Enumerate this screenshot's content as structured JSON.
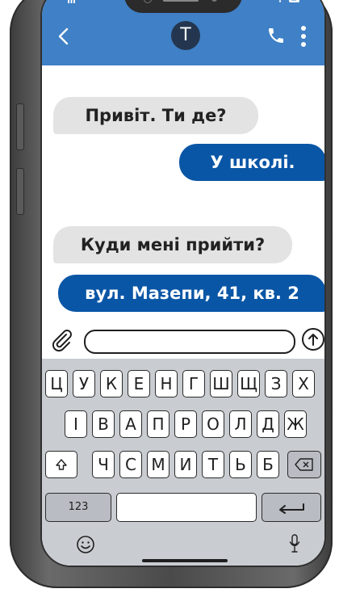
{
  "header": {
    "contact_initial": "T",
    "colors": {
      "bar": "#3f80c6",
      "avatar": "#24364f"
    },
    "icons": [
      "signal-icon",
      "wifi-icon",
      "battery-icon",
      "back-icon",
      "phone-call-icon",
      "more-icon"
    ]
  },
  "messages": [
    {
      "direction": "incoming",
      "text": "Привіт. Ти де?"
    },
    {
      "direction": "outgoing",
      "text": "У школі."
    },
    {
      "direction": "incoming",
      "text": "Куди мені прийти?"
    },
    {
      "direction": "outgoing",
      "text": "вул. Мазепи, 41, кв. 2"
    }
  ],
  "colors": {
    "incoming_bubble": "#e3e3e3",
    "outgoing_bubble": "#0a56a6"
  },
  "composer": {
    "value": "",
    "icons": [
      "paperclip-icon",
      "send-arrow-icon"
    ]
  },
  "keyboard": {
    "row1": [
      "Ц",
      "У",
      "К",
      "Е",
      "Н",
      "Г",
      "Ш",
      "Щ",
      "З",
      "Х"
    ],
    "row2": [
      "І",
      "В",
      "А",
      "П",
      "Р",
      "О",
      "Л",
      "Д",
      "Ж"
    ],
    "row3": [
      "Ч",
      "С",
      "М",
      "И",
      "Т",
      "Ь",
      "Б"
    ],
    "numbers_label": "123",
    "icons": [
      "shift-icon",
      "backspace-icon",
      "return-icon",
      "emoji-icon",
      "microphone-icon"
    ]
  }
}
